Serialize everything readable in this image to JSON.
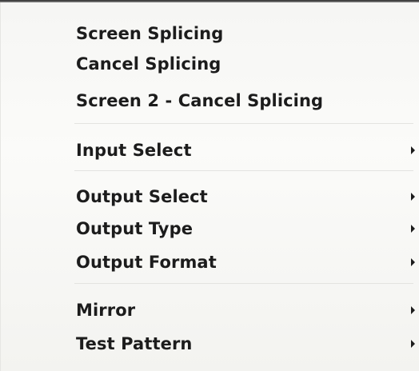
{
  "context_menu": {
    "items": [
      {
        "label": "Screen Splicing",
        "has_submenu": false
      },
      {
        "label": "Cancel Splicing",
        "has_submenu": false
      },
      {
        "label": "Screen 2 - Cancel Splicing",
        "has_submenu": false
      },
      {
        "label": "Input Select",
        "has_submenu": true
      },
      {
        "label": "Output Select",
        "has_submenu": true
      },
      {
        "label": "Output Type",
        "has_submenu": true
      },
      {
        "label": "Output Format",
        "has_submenu": true
      },
      {
        "label": "Mirror",
        "has_submenu": true
      },
      {
        "label": "Test Pattern",
        "has_submenu": true
      }
    ]
  }
}
